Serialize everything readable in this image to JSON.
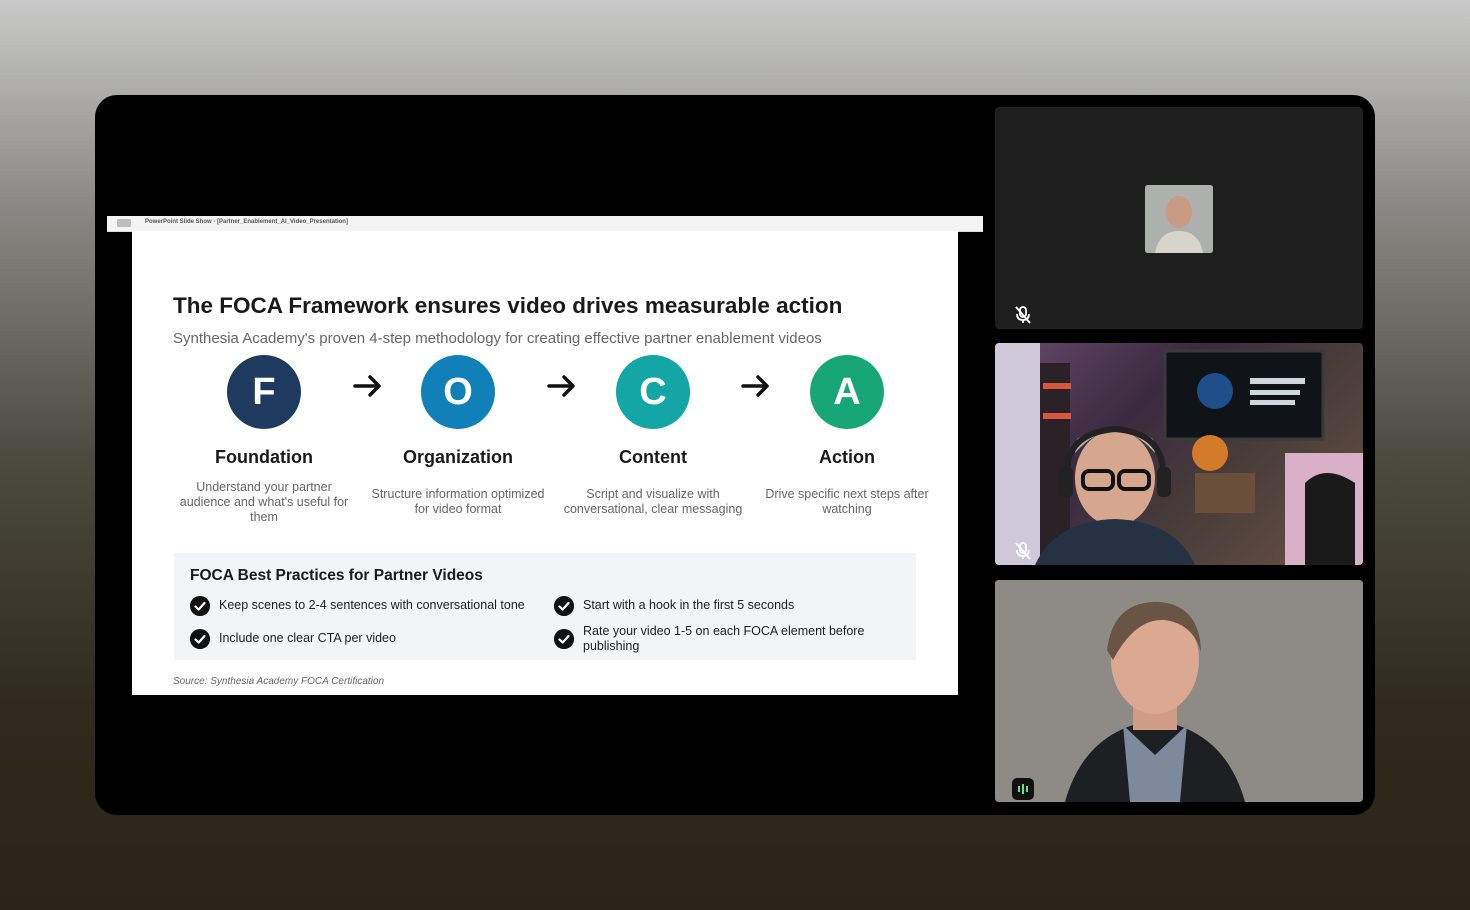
{
  "window": {
    "ppt_title": "PowerPoint Slide Show - [Partner_Enablement_AI_Video_Presentation]"
  },
  "slide": {
    "title": "The FOCA Framework ensures video drives measurable action",
    "subtitle": "Synthesia Academy's proven 4-step methodology for creating effective partner enablement videos",
    "steps": [
      {
        "letter": "F",
        "name": "Foundation",
        "desc": "Understand your partner audience and what's useful for them",
        "color": "#1f3a5f"
      },
      {
        "letter": "O",
        "name": "Organization",
        "desc": "Structure information optimized for video format",
        "color": "#1180b8"
      },
      {
        "letter": "C",
        "name": "Content",
        "desc": "Script and visualize with conversational, clear messaging",
        "color": "#14a5a5"
      },
      {
        "letter": "A",
        "name": "Action",
        "desc": "Drive specific next steps after watching",
        "color": "#17a676"
      }
    ],
    "practices_title": "FOCA Best Practices for Partner Videos",
    "practices": [
      "Keep scenes to 2-4 sentences with conversational tone",
      "Start with a hook in the first 5 seconds",
      "Include one clear CTA per video",
      "Rate your video 1-5 on each FOCA element before publishing"
    ],
    "source": "Source: Synthesia Academy FOCA Certification"
  },
  "participants": [
    {
      "type": "avatar",
      "muted": true
    },
    {
      "type": "video",
      "muted": true
    },
    {
      "type": "video",
      "muted": false,
      "speaking": true
    }
  ],
  "icons": {
    "mic_off": "mic-off-icon",
    "check": "check-circle-icon",
    "arrow": "arrow-right-icon",
    "audio": "audio-level-icon"
  }
}
